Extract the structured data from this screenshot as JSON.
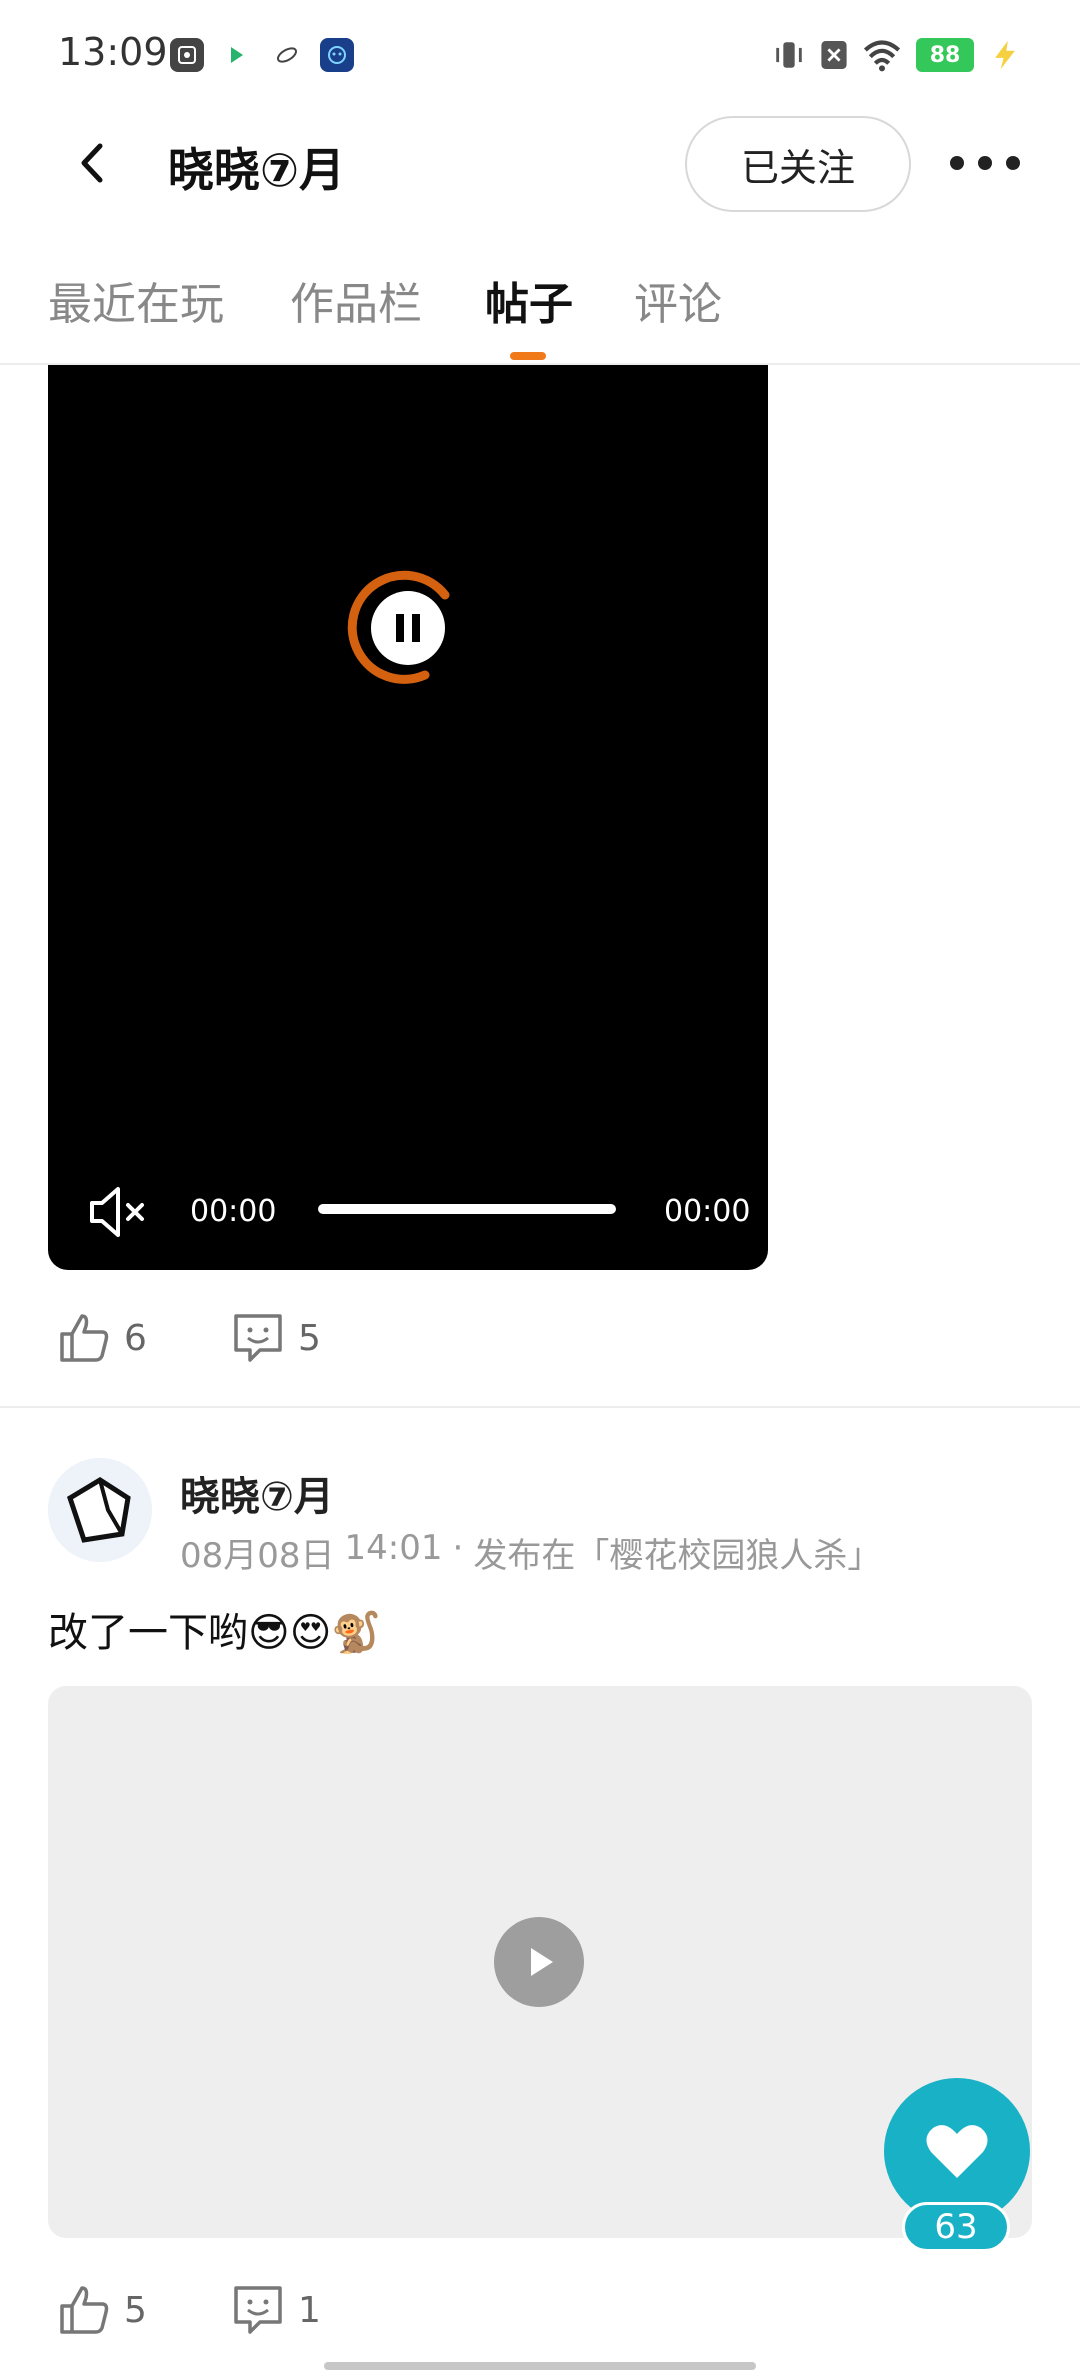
{
  "status_bar": {
    "time": "13:09",
    "battery": "88",
    "icons": [
      "scan-app-icon",
      "play-store-icon",
      "planet-app-icon",
      "robot-app-icon",
      "vibrate-icon",
      "sim-off-icon",
      "wifi-icon",
      "battery-icon",
      "charging-icon"
    ]
  },
  "header": {
    "title": "晓晓⑦月",
    "follow_label": "已关注"
  },
  "tabs": [
    {
      "label": "最近在玩",
      "active": false
    },
    {
      "label": "作品栏",
      "active": false
    },
    {
      "label": "帖子",
      "active": true
    },
    {
      "label": "评论",
      "active": false
    }
  ],
  "colors": {
    "accent": "#f07a1a",
    "like_fab": "#19b1c6"
  },
  "video_post": {
    "current_time": "00:00",
    "duration": "00:00",
    "muted": true,
    "likes": "6",
    "comments": "5"
  },
  "post": {
    "author": "晓晓⑦月",
    "date": "08月08日",
    "time": "14:01",
    "separator": "·",
    "published_in": "发布在「樱花校园狼人杀」",
    "text": "改了一下哟😎😍🐒",
    "likes": "5",
    "comments": "1"
  },
  "floating_like": {
    "count": "63"
  }
}
